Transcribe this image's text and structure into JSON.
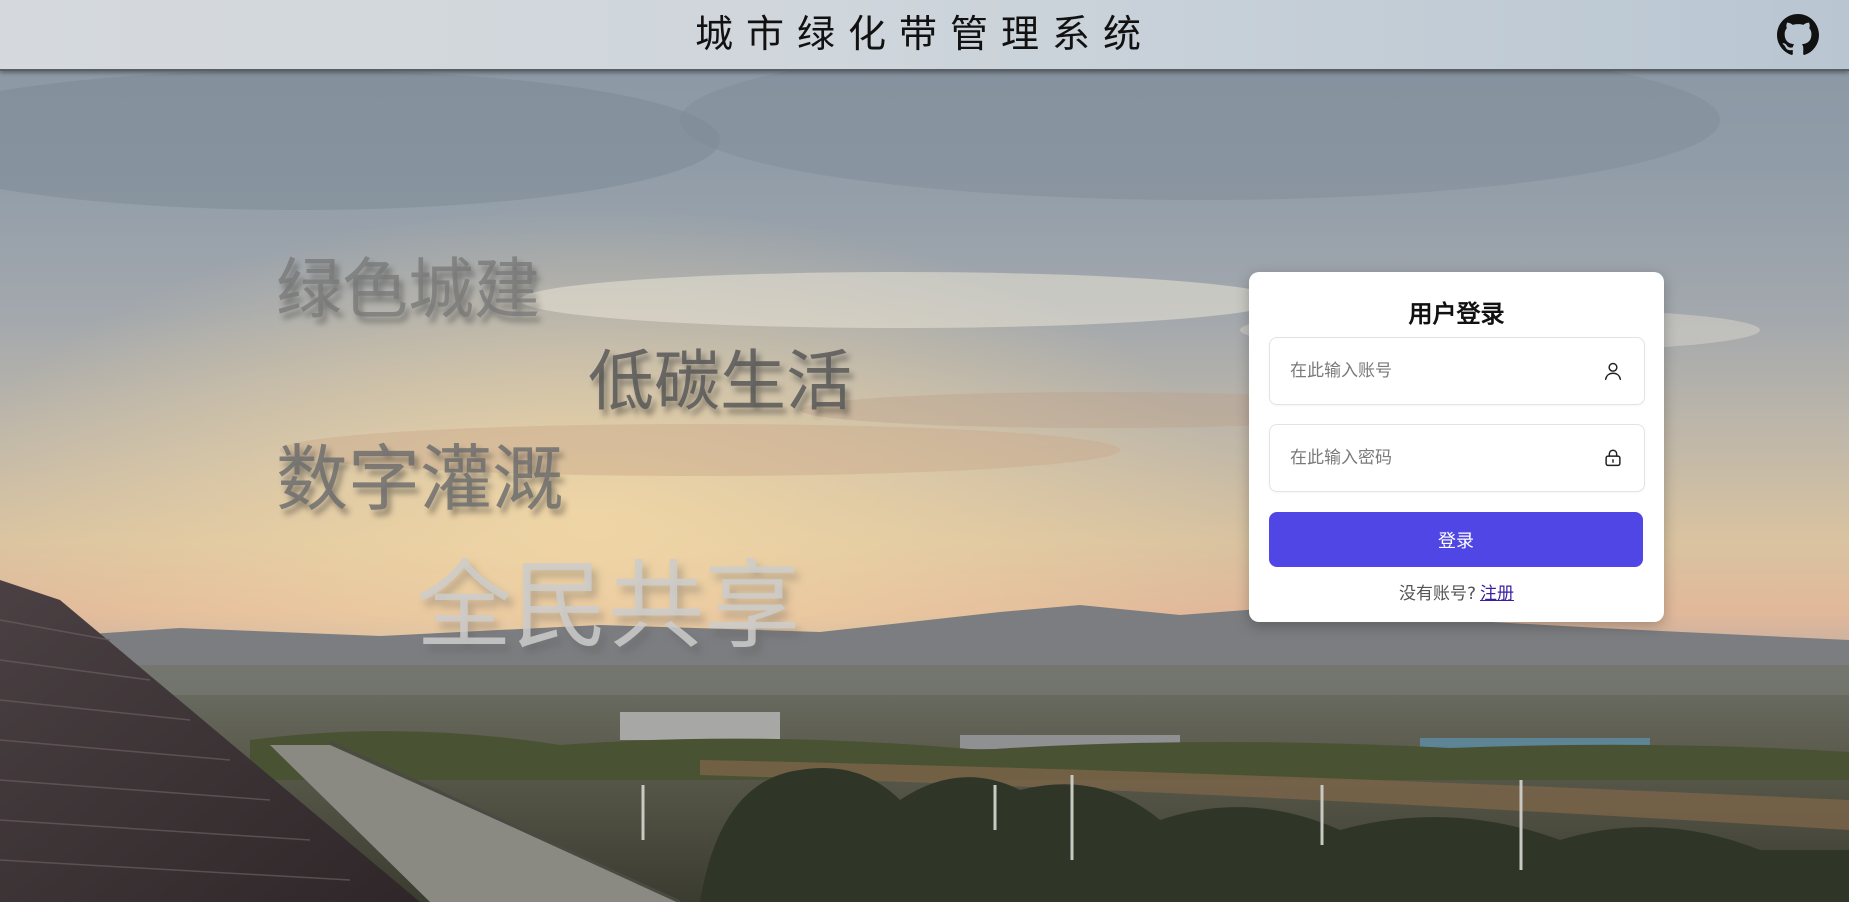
{
  "header": {
    "title": "城市绿化带管理系统",
    "github_icon": "github-icon"
  },
  "slogans": {
    "line1": "绿色城建",
    "line2": "低碳生活",
    "line3": "数字灌溉",
    "line4": "全民共享"
  },
  "login": {
    "title": "用户登录",
    "username_placeholder": "在此输入账号",
    "username_icon": "user-icon",
    "password_placeholder": "在此输入密码",
    "password_icon": "lock-icon",
    "submit_label": "登录",
    "no_account_text": "没有账号?",
    "register_label": "注册"
  },
  "colors": {
    "primary_button": "#5046e5",
    "header_border": "#5b5f63"
  }
}
